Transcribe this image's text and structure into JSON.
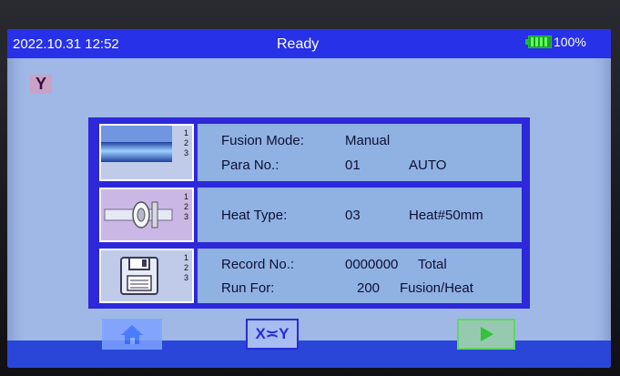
{
  "status_bar": {
    "datetime": "2022.10.31 12:52",
    "status": "Ready",
    "battery_percent": "100%"
  },
  "mode_badge": "Y",
  "rows": [
    {
      "icon": "pipe-icon",
      "numbers": [
        "1",
        "2",
        "3"
      ],
      "fields": [
        {
          "label": "Fusion Mode:",
          "value": "Manual",
          "extra": ""
        },
        {
          "label": "Para No.:",
          "value": "01",
          "extra": "AUTO"
        }
      ]
    },
    {
      "icon": "heater-icon",
      "numbers": [
        "1",
        "2",
        "3"
      ],
      "fields": [
        {
          "label": "Heat Type:",
          "value": "03",
          "extra": "Heat#50mm"
        }
      ]
    },
    {
      "icon": "save-disk-icon",
      "numbers": [
        "1",
        "2",
        "3"
      ],
      "fields": [
        {
          "label": "Record No.:",
          "value": "0000000",
          "extra": "Total"
        },
        {
          "label": "Run For:",
          "value": "200",
          "extra": "Fusion/Heat"
        }
      ]
    }
  ],
  "buttons": {
    "swap_label": "X≍Y"
  },
  "colors": {
    "top_bar": "#2731e8",
    "panel_border": "#2d28d9",
    "info_bg": "#8fb2e3",
    "play_accent": "#33c23a"
  }
}
